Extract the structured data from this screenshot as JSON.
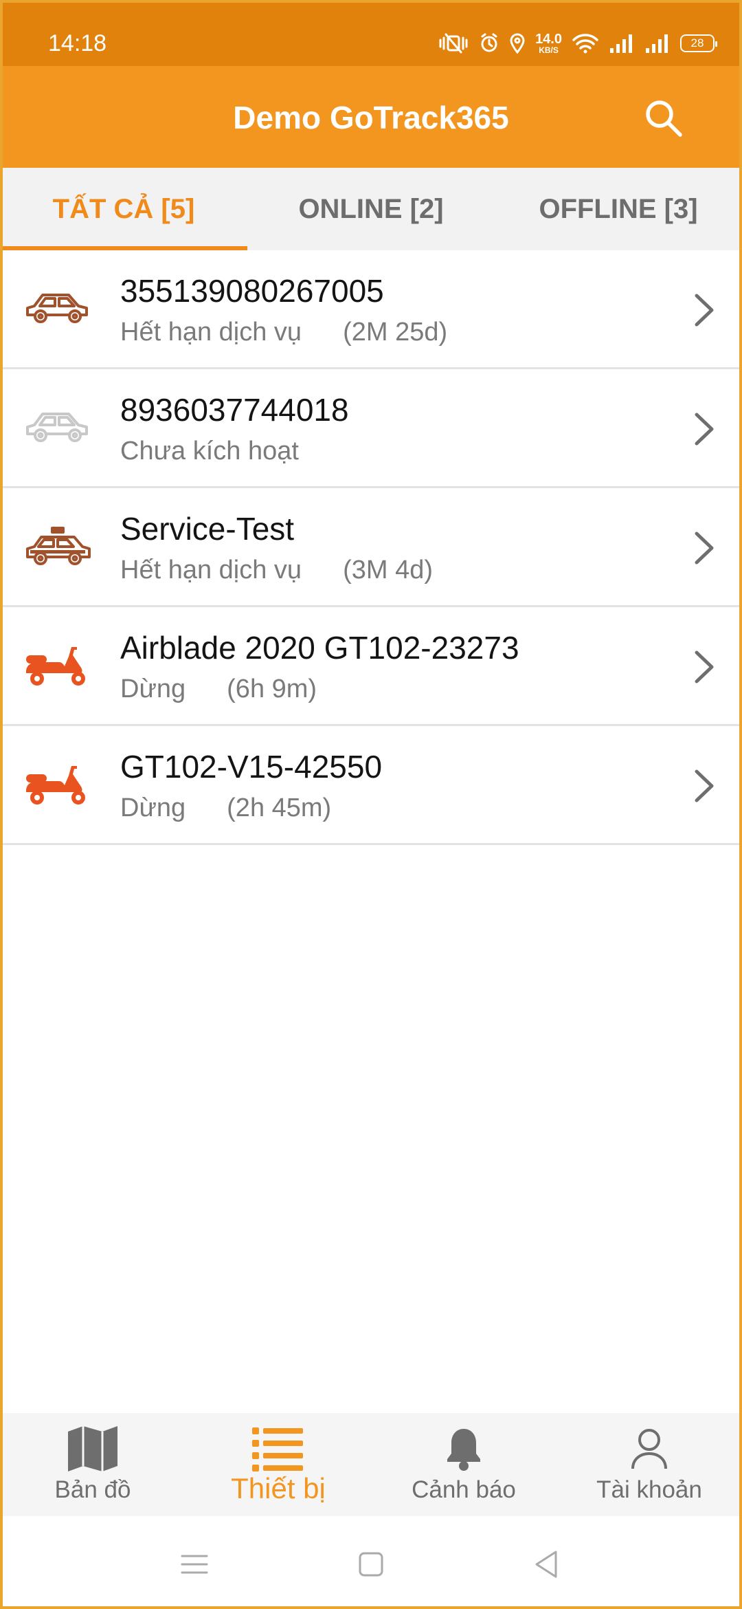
{
  "status_bar": {
    "time": "14:18",
    "net_speed_value": "14.0",
    "net_speed_unit": "KB/S",
    "battery": "28",
    "icons": [
      "mute-vibrate-icon",
      "alarm-icon",
      "location-icon",
      "wifi-icon",
      "signal-icon",
      "signal-icon",
      "battery-icon"
    ]
  },
  "app_bar": {
    "title": "Demo GoTrack365",
    "search_icon": "search-icon"
  },
  "tabs": [
    {
      "label": "TẤT CẢ [5]",
      "active": true
    },
    {
      "label": "ONLINE [2]",
      "active": false
    },
    {
      "label": "OFFLINE [3]",
      "active": false
    }
  ],
  "devices": [
    {
      "name": "355139080267005",
      "status": "Hết hạn dịch vụ",
      "duration": "(2M 25d)",
      "icon": "car-icon",
      "icon_color": "#A0522D"
    },
    {
      "name": "8936037744018",
      "status": "Chưa kích hoạt",
      "duration": "",
      "icon": "car-icon",
      "icon_color": "#C8C8C8"
    },
    {
      "name": "Service-Test",
      "status": "Hết hạn dịch vụ",
      "duration": "(3M 4d)",
      "icon": "taxi-icon",
      "icon_color": "#A0522D"
    },
    {
      "name": "Airblade 2020 GT102-23273",
      "status": "Dừng",
      "duration": "(6h 9m)",
      "icon": "scooter-icon",
      "icon_color": "#E8531F"
    },
    {
      "name": "GT102-V15-42550",
      "status": "Dừng",
      "duration": "(2h 45m)",
      "icon": "scooter-icon",
      "icon_color": "#E8531F"
    }
  ],
  "bottom_nav": [
    {
      "label": "Bản đồ",
      "icon": "map-icon",
      "active": false
    },
    {
      "label": "Thiết bị",
      "icon": "list-icon",
      "active": true
    },
    {
      "label": "Cảnh báo",
      "icon": "bell-icon",
      "active": false
    },
    {
      "label": "Tài khoản",
      "icon": "user-icon",
      "active": false
    }
  ],
  "colors": {
    "status_bar": "#E0820C",
    "app_bar": "#F29620",
    "accent": "#F08A1A",
    "car": "#A0522D",
    "inactive_car": "#C8C8C8",
    "scooter": "#E8531F"
  }
}
